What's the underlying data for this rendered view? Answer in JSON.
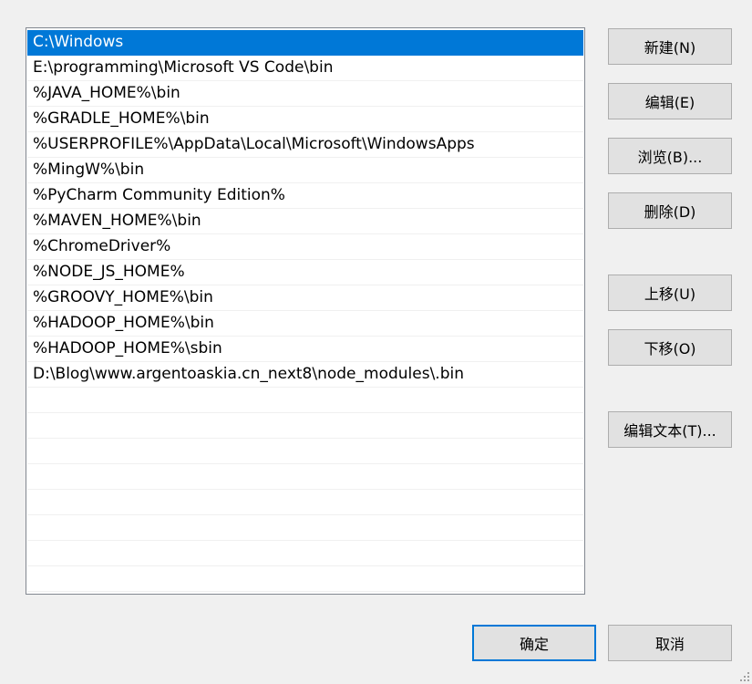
{
  "path_list": {
    "items": [
      "C:\\Windows",
      "E:\\programming\\Microsoft VS Code\\bin",
      "%JAVA_HOME%\\bin",
      "%GRADLE_HOME%\\bin",
      "%USERPROFILE%\\AppData\\Local\\Microsoft\\WindowsApps",
      "%MingW%\\bin",
      "%PyCharm Community Edition%",
      "%MAVEN_HOME%\\bin",
      "%ChromeDriver%",
      "%NODE_JS_HOME%",
      "%GROOVY_HOME%\\bin",
      "%HADOOP_HOME%\\bin",
      "%HADOOP_HOME%\\sbin",
      "D:\\Blog\\www.argentoaskia.cn_next8\\node_modules\\.bin",
      "",
      "",
      "",
      "",
      "",
      "",
      "",
      ""
    ],
    "selected_index": 0
  },
  "buttons": {
    "new": "新建(N)",
    "edit": "编辑(E)",
    "browse": "浏览(B)...",
    "delete": "删除(D)",
    "move_up": "上移(U)",
    "move_down": "下移(O)",
    "edit_text": "编辑文本(T)...",
    "ok": "确定",
    "cancel": "取消"
  },
  "colors": {
    "selection": "#0078d7",
    "dialog_background": "#f0f0f0",
    "button_face": "#e1e1e1"
  }
}
